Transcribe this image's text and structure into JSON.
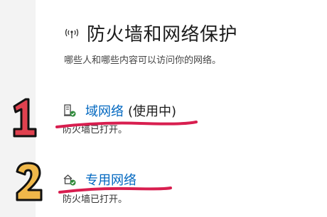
{
  "header": {
    "title": "防火墙和网络保护",
    "title_icon": "wifi-broadcast-icon",
    "subtitle": "哪些人和哪些内容可以访问你的网络。"
  },
  "networks": [
    {
      "icon": "domain-network-icon",
      "label": "域网络",
      "note": "(使用中)",
      "status": "防火墙已打开。"
    },
    {
      "icon": "private-network-icon",
      "label": "专用网络",
      "note": "",
      "status": "防火墙已打开。"
    }
  ],
  "annotations": {
    "marker1": "1",
    "marker2": "2",
    "underline_color": "#d81e4f",
    "marker1_color": "#e0414f",
    "marker2_color": "#f0b84a"
  },
  "colors": {
    "link": "#0067c0",
    "status_ok": "#2e8b3a"
  }
}
